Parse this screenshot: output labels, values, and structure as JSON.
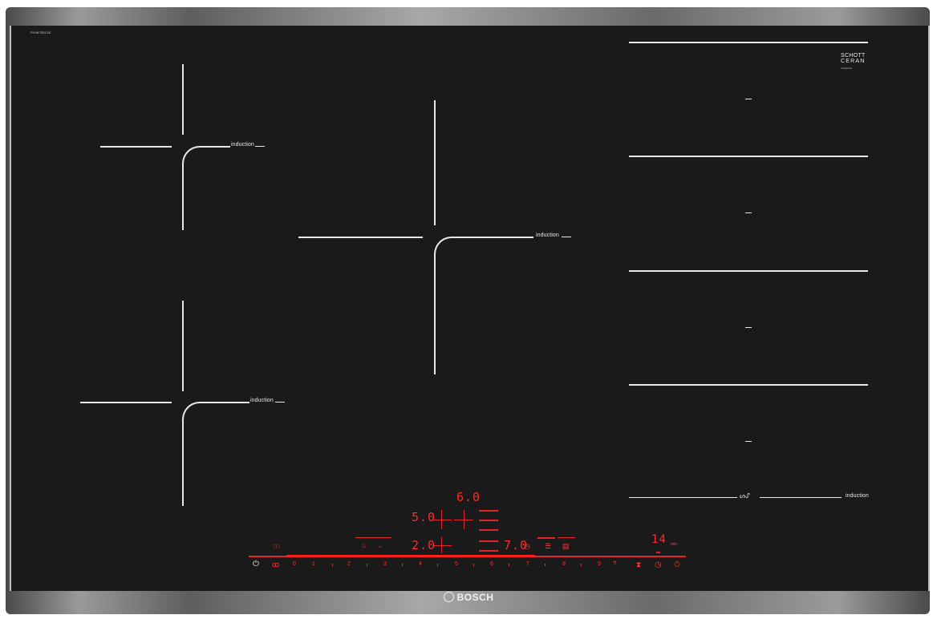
{
  "model_code": "PXV875DC1E",
  "material": {
    "line1": "SCHOTT",
    "line2": "CERAN",
    "fine": "miniprint"
  },
  "zones": {
    "top_left": {
      "label": "induction"
    },
    "bottom_left": {
      "label": "induction"
    },
    "center": {
      "label": "induction"
    },
    "flex_bottom": {
      "label": "induction"
    }
  },
  "display": {
    "top_value": "6.0",
    "left_upper_value": "5.0",
    "left_lower_value": "2.0",
    "right_value": "7.0",
    "timer_value": "14",
    "timer_unit": "min"
  },
  "slider_numbers": [
    "0",
    "1",
    "2",
    "3",
    "4",
    "5",
    "6",
    "7",
    "8",
    "9"
  ],
  "brand": {
    "name": "BOSCH"
  },
  "colors": {
    "glass": "#1a1a1a",
    "lines": "#e8e8e8",
    "display": "#e0262a"
  },
  "icons": [
    "power-icon",
    "child-lock-icon",
    "flame-icon",
    "pan-icon",
    "clock-icon",
    "list-icon",
    "menu-icon",
    "timer-icon",
    "stopwatch-icon",
    "brand-logo-icon"
  ]
}
